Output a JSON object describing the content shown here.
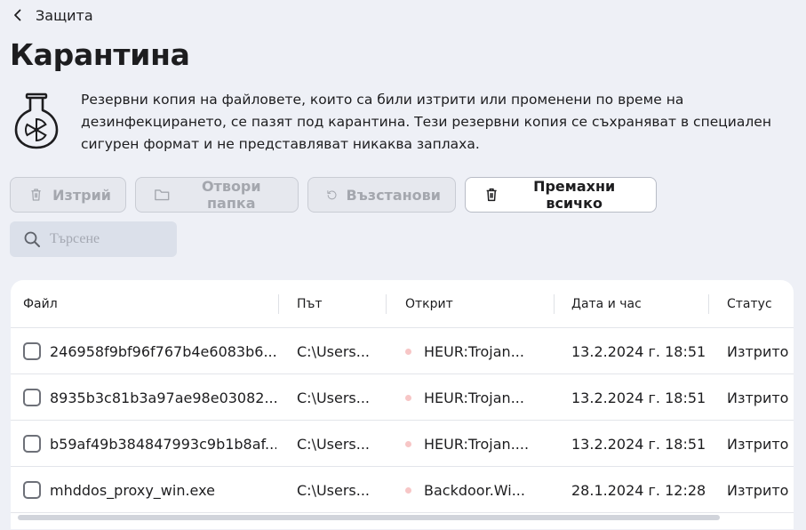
{
  "nav": {
    "back_label": "Защита"
  },
  "page": {
    "title": "Карантина",
    "description": "Резервни копия на файловете, които са били изтрити или променени по време на дезинфекцирането, се пазят под карантина. Тези резервни копия се съхраняват в специален сигурен формат и не представляват никаква заплаха."
  },
  "toolbar": {
    "delete_label": "Изтрий",
    "open_folder_label": "Отвори папка",
    "restore_label": "Възстанови",
    "remove_all_label": "Премахни всичко"
  },
  "search": {
    "placeholder": "Търсене"
  },
  "table": {
    "headers": {
      "file": "Файл",
      "path": "Път",
      "detected": "Открит",
      "datetime": "Дата и час",
      "status": "Статус"
    },
    "rows": [
      {
        "file": "246958f9bf96f767b4e6083b6...",
        "path": "C:\\Users...",
        "detected": "HEUR:Trojan...",
        "datetime": "13.2.2024 г. 18:51",
        "status": "Изтрито"
      },
      {
        "file": "8935b3c81b3a97ae98e03082...",
        "path": "C:\\Users...",
        "detected": "HEUR:Trojan...",
        "datetime": "13.2.2024 г. 18:51",
        "status": "Изтрито"
      },
      {
        "file": "b59af49b384847993c9b1b8af...",
        "path": "C:\\Users...",
        "detected": "HEUR:Trojan....",
        "datetime": "13.2.2024 г. 18:51",
        "status": "Изтрито"
      },
      {
        "file": "mhddos_proxy_win.exe",
        "path": "C:\\Users...",
        "detected": "Backdoor.Wi...",
        "datetime": "28.1.2024 г. 12:28",
        "status": "Изтрито"
      }
    ]
  },
  "icons": {
    "back": "chevron-left-icon",
    "flask": "radiation-flask-icon",
    "delete": "trash-icon",
    "open_folder": "folder-icon",
    "restore": "restore-icon",
    "remove_all": "trash-icon",
    "search": "search-icon"
  },
  "colors": {
    "background": "#eef0f6",
    "threat_dot": "#f7c6c6",
    "disabled_text": "#a4a7ae"
  }
}
